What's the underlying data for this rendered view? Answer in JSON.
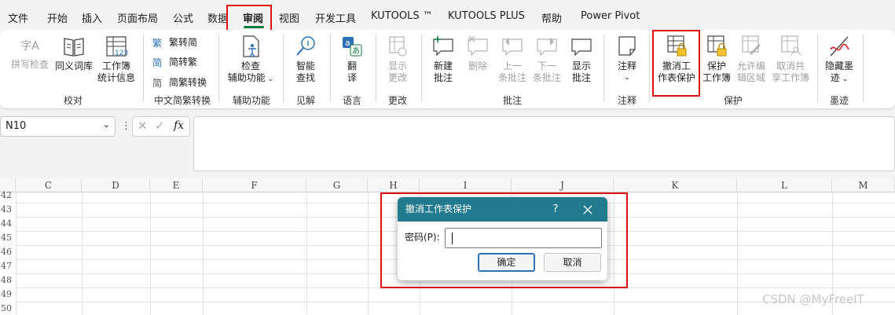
{
  "menu": {
    "tabs": [
      {
        "label": "文件"
      },
      {
        "label": "开始"
      },
      {
        "label": "插入"
      },
      {
        "label": "页面布局"
      },
      {
        "label": "公式"
      },
      {
        "label": "数据"
      },
      {
        "label": "审阅"
      },
      {
        "label": "视图"
      },
      {
        "label": "开发工具"
      },
      {
        "label": "KUTOOLS ™"
      },
      {
        "label": "KUTOOLS PLUS"
      },
      {
        "label": "帮助"
      },
      {
        "label": "Power Pivot"
      }
    ],
    "active_tab": "审阅"
  },
  "ribbon": {
    "proofing": {
      "spell_check": [
        "拼写检查",
        "字A"
      ],
      "thesaurus": "同义词库",
      "workbook_stats": [
        "工作簿",
        "统计信息"
      ],
      "group": "校对"
    },
    "chinese_conversion": {
      "to_traditional": "繁转简",
      "to_simplified": "简转繁",
      "convert": "简繁转换",
      "group": "中文简繁转换"
    },
    "accessibility": {
      "check": [
        "检查",
        "辅助功能"
      ],
      "group": "辅助功能"
    },
    "insights": {
      "smart_lookup": [
        "智能",
        "查找"
      ],
      "group": "见解"
    },
    "language": {
      "translate": [
        "翻",
        "译"
      ],
      "group": "语言"
    },
    "changes": {
      "show_changes": [
        "显示",
        "更改"
      ],
      "group": "更改"
    },
    "comments": {
      "new": [
        "新建",
        "批注"
      ],
      "delete": "删除",
      "previous": [
        "上一",
        "条批注"
      ],
      "next": [
        "下一",
        "条批注"
      ],
      "show": [
        "显示",
        "批注"
      ],
      "group": "批注"
    },
    "notes": {
      "notes": "注释",
      "group": "注释"
    },
    "protect": {
      "unprotect_sheet": [
        "撤消工",
        "作表保护"
      ],
      "protect_workbook": [
        "保护",
        "工作簿"
      ],
      "allow_edit": [
        "允许编",
        "辑区域"
      ],
      "unshare": [
        "取消共",
        "享工作簿"
      ],
      "group": "保护"
    },
    "ink": {
      "hide_ink": [
        "隐藏墨",
        "迹"
      ],
      "group": "墨迹"
    }
  },
  "formula_bar": {
    "name_box": "N10",
    "fx": "fx",
    "formula": ""
  },
  "grid": {
    "columns": [
      "C",
      "D",
      "E",
      "F",
      "G",
      "H",
      "I",
      "J",
      "K",
      "L",
      "M"
    ],
    "rows": [
      "42",
      "43",
      "44",
      "45",
      "46",
      "47",
      "48",
      "49",
      "50"
    ]
  },
  "dialog": {
    "title": "撤消工作表保护",
    "help": "?",
    "password_label": "密码(P):",
    "password_value": "",
    "ok": "确定",
    "cancel": "取消"
  },
  "watermark": "CSDN @MyFreeIT",
  "colors": {
    "accent_green": "#107c41",
    "dialog_title_bg": "#217a8d",
    "highlight_red": "#e01010",
    "lock_yellow": "#f2c230"
  }
}
